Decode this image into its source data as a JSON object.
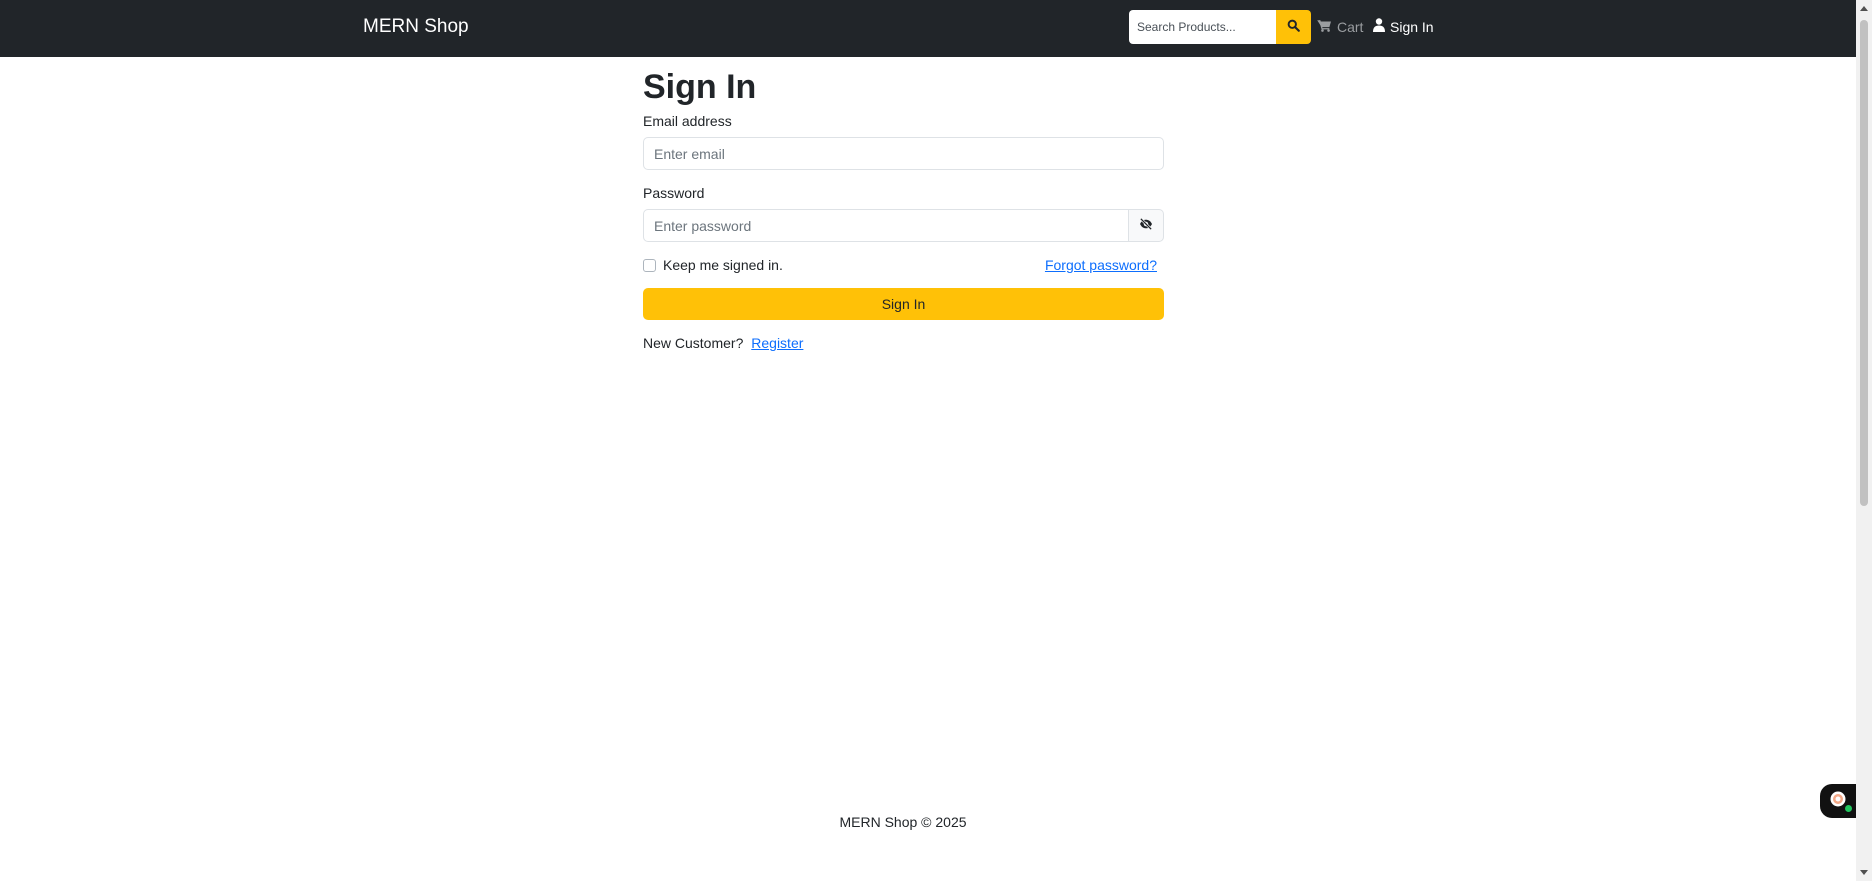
{
  "navbar": {
    "brand": "MERN Shop",
    "search": {
      "placeholder": "Search Products...",
      "value": ""
    },
    "search_icon": "search-icon",
    "cart": {
      "label": "Cart",
      "icon": "cart-icon"
    },
    "signin": {
      "label": "Sign In",
      "icon": "user-icon"
    }
  },
  "form": {
    "title": "Sign In",
    "email": {
      "label": "Email address",
      "placeholder": "Enter email",
      "value": ""
    },
    "password": {
      "label": "Password",
      "placeholder": "Enter password",
      "value": "",
      "toggle_icon": "eye-slash-icon"
    },
    "remember_label": "Keep me signed in.",
    "remember_checked": false,
    "forgot_label": "Forgot password?",
    "submit_label": "Sign In",
    "new_customer_text": "New Customer?",
    "register_label": "Register"
  },
  "footer": {
    "text": "MERN Shop © 2025"
  },
  "colors": {
    "navbar_bg": "#212529",
    "accent": "#ffc107",
    "link": "#0d6efd"
  },
  "chat_widget": {
    "icon": "chat-icon",
    "status": "online"
  }
}
